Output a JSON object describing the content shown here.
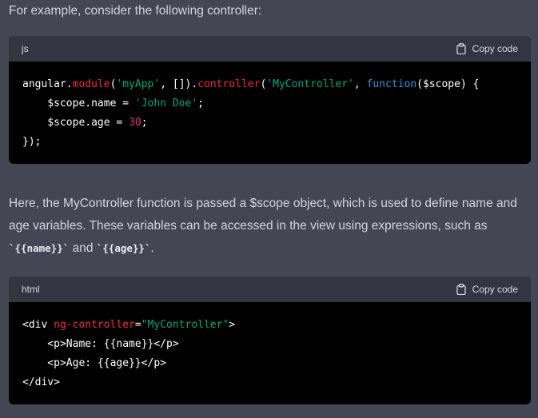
{
  "intro": {
    "text": "For example, consider the following controller:"
  },
  "code_blocks": [
    {
      "language": "js",
      "copy_label": "Copy code",
      "lines": [
        [
          {
            "t": "angular",
            "c": "plain"
          },
          {
            "t": ".",
            "c": "plain"
          },
          {
            "t": "module",
            "c": "fn"
          },
          {
            "t": "(",
            "c": "plain"
          },
          {
            "t": "'myApp'",
            "c": "str"
          },
          {
            "t": ", []).",
            "c": "plain"
          },
          {
            "t": "controller",
            "c": "fn"
          },
          {
            "t": "(",
            "c": "plain"
          },
          {
            "t": "'MyController'",
            "c": "str"
          },
          {
            "t": ", ",
            "c": "plain"
          },
          {
            "t": "function",
            "c": "kw"
          },
          {
            "t": "($scope) {",
            "c": "plain"
          }
        ],
        [
          {
            "t": "    $scope.name = ",
            "c": "plain"
          },
          {
            "t": "'John Doe'",
            "c": "str"
          },
          {
            "t": ";",
            "c": "plain"
          }
        ],
        [
          {
            "t": "    $scope.age = ",
            "c": "plain"
          },
          {
            "t": "30",
            "c": "num"
          },
          {
            "t": ";",
            "c": "plain"
          }
        ],
        [
          {
            "t": "});",
            "c": "plain"
          }
        ]
      ]
    },
    {
      "language": "html",
      "copy_label": "Copy code",
      "lines": [
        [
          {
            "t": "<div ",
            "c": "plain"
          },
          {
            "t": "ng-controller",
            "c": "fn"
          },
          {
            "t": "=",
            "c": "plain"
          },
          {
            "t": "\"MyController\"",
            "c": "str"
          },
          {
            "t": ">",
            "c": "plain"
          }
        ],
        [
          {
            "t": "    <p>Name: {{name}}</p>",
            "c": "plain"
          }
        ],
        [
          {
            "t": "    <p>Age: {{age}}</p>",
            "c": "plain"
          }
        ],
        [
          {
            "t": "</div>",
            "c": "plain"
          }
        ]
      ]
    }
  ],
  "explanation": {
    "text_before": "Here, the MyController function is passed a $scope object, which is used to define name and age variables. These variables can be accessed in the view using expressions, such as ",
    "code_1": "`{{name}}`",
    "text_middle": " and ",
    "code_2": "`{{age}}`",
    "text_after": "."
  }
}
